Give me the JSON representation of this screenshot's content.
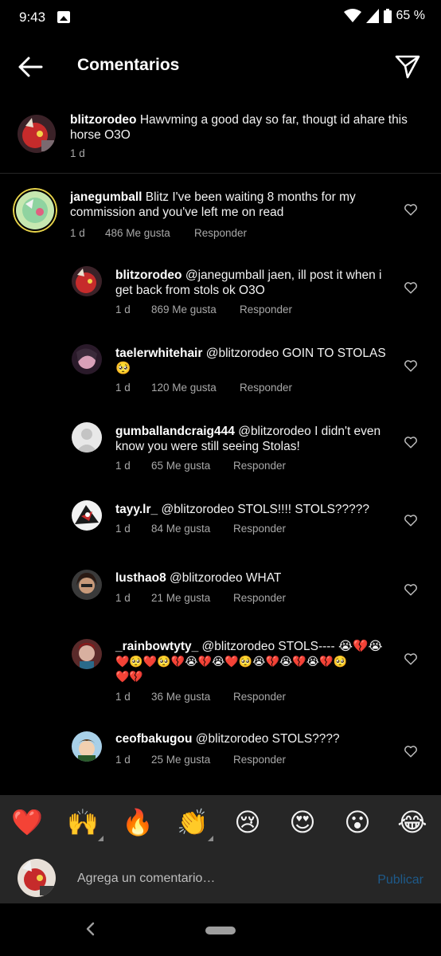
{
  "status_bar": {
    "time": "9:43",
    "battery": "65 %"
  },
  "header": {
    "title": "Comentarios"
  },
  "caption": {
    "username": "blitzorodeo",
    "text": "Hawvming a good day so far, thougt id ahare this horse O3O",
    "time": "1 d"
  },
  "comments": [
    {
      "username": "janegumball",
      "text_line1": "Blitz I've been waiting 8 months for my",
      "text_line2": "commission and you've left me on read",
      "time": "1 d",
      "likes": "486 Me gusta",
      "reply": "Responder"
    },
    {
      "username": "blitzorodeo",
      "text_line1": "@janegumball jaen, ill post it when i",
      "text_line2": "get back from stols ok O3O",
      "time": "1 d",
      "likes": "869 Me gusta",
      "reply": "Responder"
    },
    {
      "username": "taelerwhitehair",
      "text_line1": "@blitzorodeo GOIN TO STOLAS",
      "text_line2": "🥺",
      "time": "1 d",
      "likes": "120 Me gusta",
      "reply": "Responder"
    },
    {
      "username": "gumballandcraig444",
      "text_line1": "@blitzorodeo I didn't even",
      "text_line2": "know you were still seeing Stolas!",
      "time": "1 d",
      "likes": "65 Me gusta",
      "reply": "Responder"
    },
    {
      "username": "tayy.lr_",
      "text_line1": "@blitzorodeo STOLS!!!! STOLS?????",
      "text_line2": "",
      "time": "1 d",
      "likes": "84 Me gusta",
      "reply": "Responder"
    },
    {
      "username": "lusthao8",
      "text_line1": "@blitzorodeo WHAT",
      "text_line2": "",
      "time": "1 d",
      "likes": "21 Me gusta",
      "reply": "Responder"
    },
    {
      "username": "_rainbowtyty_",
      "text_line1": "@blitzorodeo STOLS---- 😭💔😭",
      "text_line2": "❤️🥺❤️🥺💔😭💔😭❤️🥺😭💔😭💔😭💔🥺",
      "text_line3": "❤️💔",
      "time": "1 d",
      "likes": "36 Me gusta",
      "reply": "Responder"
    },
    {
      "username": "ceofbakugou",
      "text_line1": "@blitzorodeo STOLS????",
      "text_line2": "",
      "time": "1 d",
      "likes": "25 Me gusta",
      "reply": "Responder"
    }
  ],
  "emoji_bar": [
    "❤️",
    "🙌",
    "🔥",
    "👏",
    "😢",
    "😍",
    "😮",
    "😂"
  ],
  "compose": {
    "placeholder": "Agrega un comentario…",
    "publish": "Publicar"
  },
  "colors": {
    "background": "#000000",
    "text": "#f2f2f2",
    "meta": "#a8a8a8",
    "bar": "#262626",
    "publish_disabled": "#1e5a8a"
  }
}
